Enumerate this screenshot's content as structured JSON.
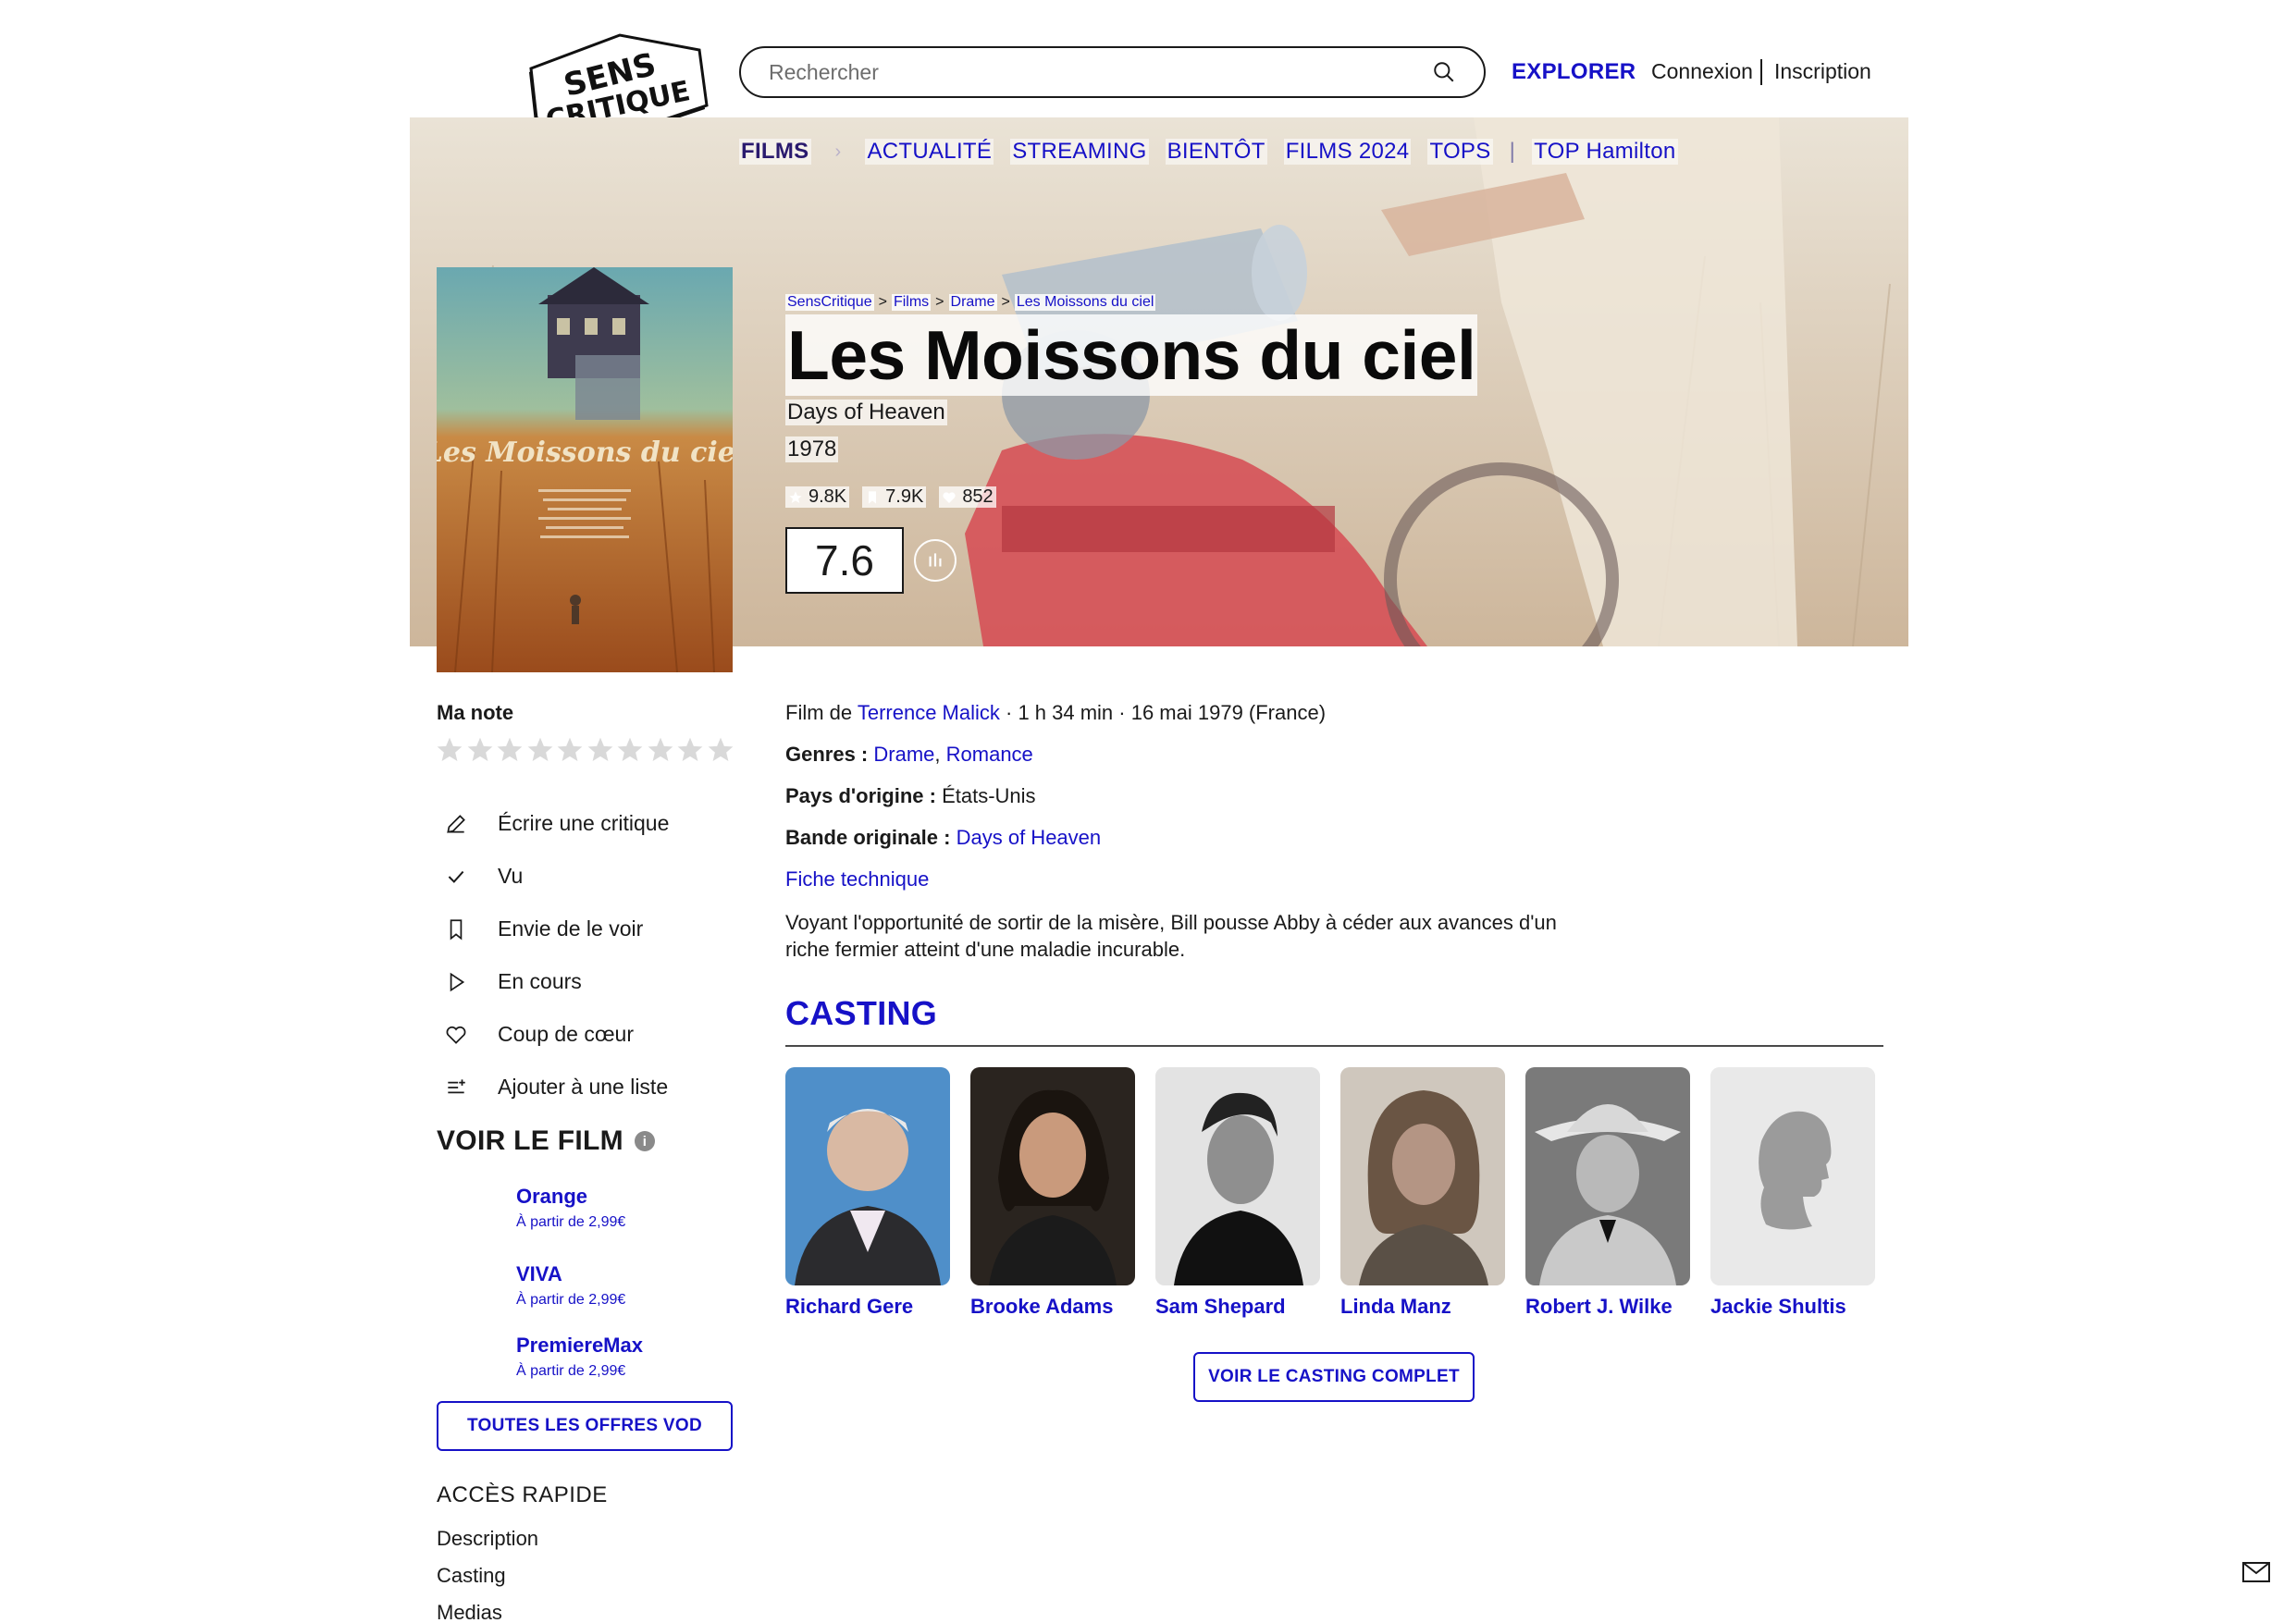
{
  "header": {
    "logo_line1": "SENS",
    "logo_line2": "CRITIQUE",
    "search_placeholder": "Rechercher",
    "explorer": "EXPLORER",
    "connexion": "Connexion",
    "inscription": "Inscription"
  },
  "nav": {
    "films": "FILMS",
    "items": [
      "ACTUALITÉ",
      "STREAMING",
      "BIENTÔT",
      "FILMS 2024",
      "TOPS"
    ],
    "top": "TOP Hamilton"
  },
  "breadcrumb": [
    "SensCritique",
    "Films",
    "Drame",
    "Les Moissons du ciel"
  ],
  "movie": {
    "title": "Les Moissons du ciel",
    "original_title": "Days of Heaven",
    "year": "1978",
    "stats": {
      "ratings": "9.8K",
      "wishlist": "7.9K",
      "favorites": "852"
    },
    "score": "7.6",
    "poster_text": "Les Moissons du ciel",
    "director_prefix": "Film de",
    "director": "Terrence Malick",
    "details": " · 1 h 34 min · 16 mai 1979 (France)",
    "genres_label": "Genres :",
    "genres": [
      "Drame",
      "Romance"
    ],
    "country_label": "Pays d'origine :",
    "country": "États-Unis",
    "soundtrack_label": "Bande originale :",
    "soundtrack": "Days of Heaven",
    "fiche": "Fiche technique",
    "synopsis": "Voyant l'opportunité de sortir de la misère, Bill pousse Abby à céder aux avances d'un riche fermier atteint d'une maladie incurable."
  },
  "sidebar": {
    "ma_note": "Ma note",
    "stars_count": 10,
    "actions": [
      {
        "label": "Écrire une critique",
        "icon": "pencil-icon"
      },
      {
        "label": "Vu",
        "icon": "check-icon"
      },
      {
        "label": "Envie de le voir",
        "icon": "bookmark-icon"
      },
      {
        "label": "En cours",
        "icon": "play-icon"
      },
      {
        "label": "Coup de cœur",
        "icon": "heart-icon"
      },
      {
        "label": "Ajouter à une liste",
        "icon": "list-add-icon"
      }
    ],
    "voir_le_film": "VOIR LE FILM",
    "vod": [
      {
        "name": "Orange",
        "price": "À partir de 2,99€"
      },
      {
        "name": "VIVA",
        "price": "À partir de 2,99€"
      },
      {
        "name": "PremiereMax",
        "price": "À partir de 2,99€"
      }
    ],
    "vod_button": "TOUTES LES OFFRES VOD",
    "acces_rapide": "ACCÈS RAPIDE",
    "quick_links": [
      "Description",
      "Casting",
      "Medias"
    ]
  },
  "casting": {
    "heading": "CASTING",
    "actors": [
      "Richard Gere",
      "Brooke Adams",
      "Sam Shepard",
      "Linda Manz",
      "Robert J. Wilke",
      "Jackie Shultis"
    ],
    "button": "VOIR LE CASTING COMPLET"
  },
  "colors": {
    "accent": "#1611c7",
    "text": "#1a1a1a"
  }
}
